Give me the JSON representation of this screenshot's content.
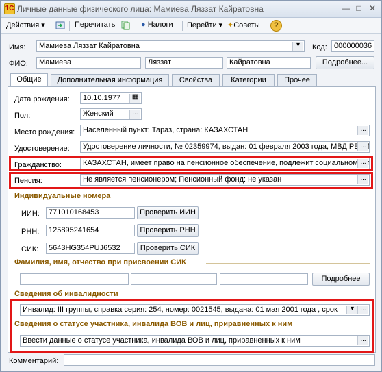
{
  "window": {
    "title": "Личные данные физического лица: Мамиева Ляззат Кайратовна"
  },
  "toolbar": {
    "actions": "Действия",
    "reread": "Перечитать",
    "taxes": "Налоги",
    "goto": "Перейти",
    "tips": "Советы"
  },
  "header": {
    "name_label": "Имя:",
    "name_value": "Мамиева Ляззат Кайратовна",
    "code_label": "Код:",
    "code_value": "000000036",
    "fio_label": "ФИО:",
    "surname": "Мамиева",
    "first_name": "Ляззат",
    "patronymic": "Кайратовна",
    "more_button": "Подробнее..."
  },
  "tabs": [
    "Общие",
    "Дополнительная информация",
    "Свойства",
    "Категории",
    "Прочее"
  ],
  "general": {
    "birth_date_label": "Дата рождения:",
    "birth_date": "10.10.1977",
    "gender_label": "Пол:",
    "gender": "Женский",
    "birthplace_label": "Место рождения:",
    "birthplace": "Населенный пункт: Тараз, страна: КАЗАХСТАН",
    "id_doc_label": "Удостоверение:",
    "id_doc": "Удостоверение личности, № 02359974, выдан: 01 февраля 2003 года, МВД РЕСПУБЛИКИ КАЗАХСТАН",
    "citizenship_label": "Гражданство:",
    "citizenship": "КАЗАХСТАН, имеет право на пенсионное обеспечение, подлежит социальному страхованию",
    "pension_label": "Пенсия:",
    "pension": "Не является пенсионером; Пенсионный фонд: не указан"
  },
  "individual_numbers": {
    "title": "Индивидуальные номера",
    "iin_label": "ИИН:",
    "iin": "771010168453",
    "iin_check": "Проверить ИИН",
    "rnn_label": "РНН:",
    "rnn": "125895241654",
    "rnn_check": "Проверить РНН",
    "sik_label": "СИК:",
    "sik": "5643HG354PUJ6532",
    "sik_check": "Проверить СИК"
  },
  "sik_name": {
    "title": "Фамилия, имя, отчество при присвоении СИК",
    "more_button": "Подробнее"
  },
  "disability": {
    "title": "Сведения об инвалидности",
    "value": "Инвалид: III группы, справка серия: 254, номер: 0021545, выдана: 01 мая 2001 года , срок"
  },
  "veteran": {
    "title": "Сведения о статусе участника, инвалида ВОВ и лиц, приравненных к ним",
    "value": "Ввести данные о статусе участника, инвалида ВОВ и лиц, приравненных к ним"
  },
  "comment": {
    "label": "Комментарий:",
    "value": ""
  }
}
